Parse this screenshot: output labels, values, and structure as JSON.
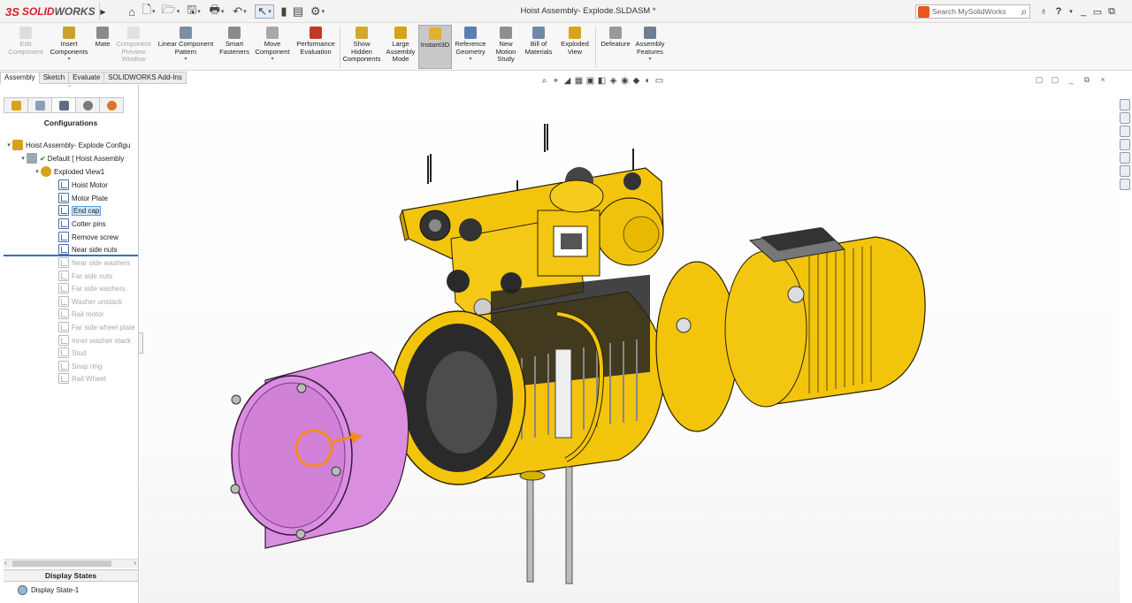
{
  "title_bar": {
    "brand_ds": "3S",
    "brand_solid": "SOLID",
    "brand_works": "WORKS",
    "document_title": "Hoist Assembly- Explode.SLDASM *",
    "search_placeholder": "Search MySolidWorks",
    "help_label": "?",
    "window_controls": [
      "_",
      "▭",
      "⧉"
    ]
  },
  "command_manager": {
    "buttons": [
      {
        "label": "Edit Component",
        "lines": [
          "Edit",
          "Component"
        ],
        "disabled": true
      },
      {
        "label": "Insert Components",
        "lines": [
          "Insert",
          "Components"
        ],
        "dropdown": true
      },
      {
        "label": "Mate",
        "lines": [
          "Mate"
        ]
      },
      {
        "label": "Component Preview Window",
        "lines": [
          "Component",
          "Preview",
          "Window"
        ],
        "disabled": true
      },
      {
        "label": "Linear Component Pattern",
        "lines": [
          "Linear Component",
          "Pattern"
        ],
        "dropdown": true
      },
      {
        "label": "Smart Fasteners",
        "lines": [
          "Smart",
          "Fasteners"
        ]
      },
      {
        "label": "Move Component",
        "lines": [
          "Move",
          "Component"
        ],
        "dropdown": true
      },
      {
        "label": "Performance Evaluation",
        "lines": [
          "Performance",
          "Evaluation"
        ]
      },
      {
        "label": "Show Hidden Components",
        "lines": [
          "Show",
          "Hidden",
          "Components"
        ]
      },
      {
        "label": "Large Assembly Mode",
        "lines": [
          "Large",
          "Assembly",
          "Mode"
        ]
      },
      {
        "label": "Instant3D",
        "lines": [
          "Instant3D"
        ],
        "active": true
      },
      {
        "label": "Reference Geometry",
        "lines": [
          "Reference",
          "Geometry"
        ],
        "dropdown": true
      },
      {
        "label": "New Motion Study",
        "lines": [
          "New",
          "Motion",
          "Study"
        ]
      },
      {
        "label": "Bill of Materials",
        "lines": [
          "Bill of",
          "Materials"
        ]
      },
      {
        "label": "Exploded View",
        "lines": [
          "Exploded",
          "View"
        ]
      },
      {
        "label": "Defeature",
        "lines": [
          "Defeature"
        ]
      },
      {
        "label": "Assembly Features",
        "lines": [
          "Assembly",
          "Features"
        ],
        "dropdown": true
      }
    ]
  },
  "tabs": [
    "Assembly",
    "Sketch",
    "Evaluate",
    "SOLIDWORKS Add-Ins"
  ],
  "config_panel": {
    "header": "Configurations",
    "root": "Hoist Assembly- Explode Configu",
    "default_config": "Default [ Hoist Assembly",
    "exploded_view": "Exploded View1",
    "active_steps": [
      "Hoist Motor",
      "Motor Plate",
      "End cap",
      "Cotter pins",
      "Remove screw",
      "Near side nuts"
    ],
    "suppressed_steps": [
      "Near side washers",
      "Far side nuts",
      "Far side washers",
      "Washer unstack",
      "Rail motor",
      "Far side wheel plate",
      "Inner washer stack",
      "Stud",
      "Snap ring",
      "Rail Wheel"
    ],
    "selected_step": "End cap",
    "display_states_header": "Display States",
    "display_state": "Display State-1"
  },
  "colors": {
    "yellow_part": "#f2c40c",
    "purple_part": "#d98ee0",
    "accent_orange": "#f58a1f",
    "selection_blue": "#5a9ee0"
  }
}
